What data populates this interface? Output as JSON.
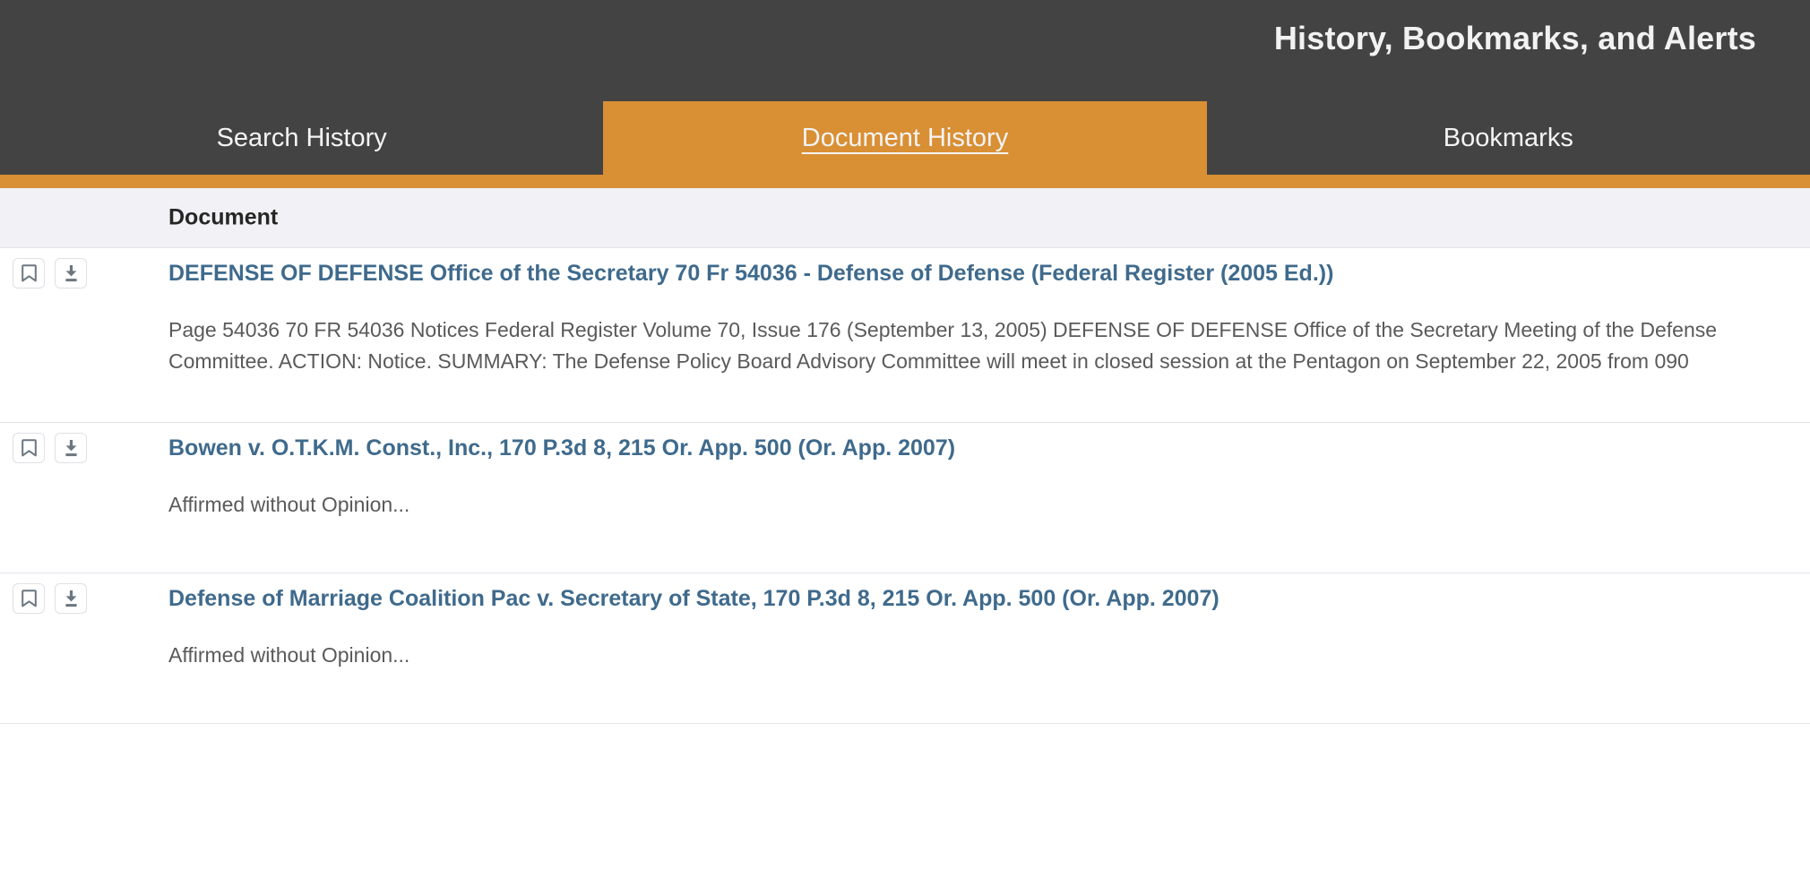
{
  "header": {
    "title": "History, Bookmarks, and Alerts",
    "accent_color": "#d98f34",
    "background_color": "#434343",
    "tabs": [
      {
        "label": "Search History",
        "active": false
      },
      {
        "label": "Document History",
        "active": true
      },
      {
        "label": "Bookmarks",
        "active": false
      }
    ]
  },
  "table": {
    "columns": [
      {
        "label": "Document"
      }
    ],
    "row_actions": [
      {
        "icon": "bookmark-icon",
        "label": "Bookmark"
      },
      {
        "icon": "download-icon",
        "label": "Download"
      }
    ],
    "rows": [
      {
        "title": "DEFENSE OF DEFENSE Office of the Secretary 70 Fr 54036 - Defense of Defense (Federal Register (2005 Ed.))",
        "snippet": "Page 54036 70 FR 54036 Notices Federal Register Volume 70, Issue 176 (September 13, 2005) DEFENSE OF DEFENSE Office of the Secretary Meeting of the Defense\nCommittee. ACTION: Notice. SUMMARY: The Defense Policy Board Advisory Committee will meet in closed session at the Pentagon on September 22, 2005 from 090"
      },
      {
        "title": "Bowen v. O.T.K.M. Const., Inc., 170 P.3d 8, 215 Or. App. 500 (Or. App. 2007)",
        "snippet": "Affirmed without Opinion..."
      },
      {
        "title": "Defense of Marriage Coalition Pac v. Secretary of State, 170 P.3d 8, 215 Or. App. 500 (Or. App. 2007)",
        "snippet": "Affirmed without Opinion..."
      }
    ]
  }
}
